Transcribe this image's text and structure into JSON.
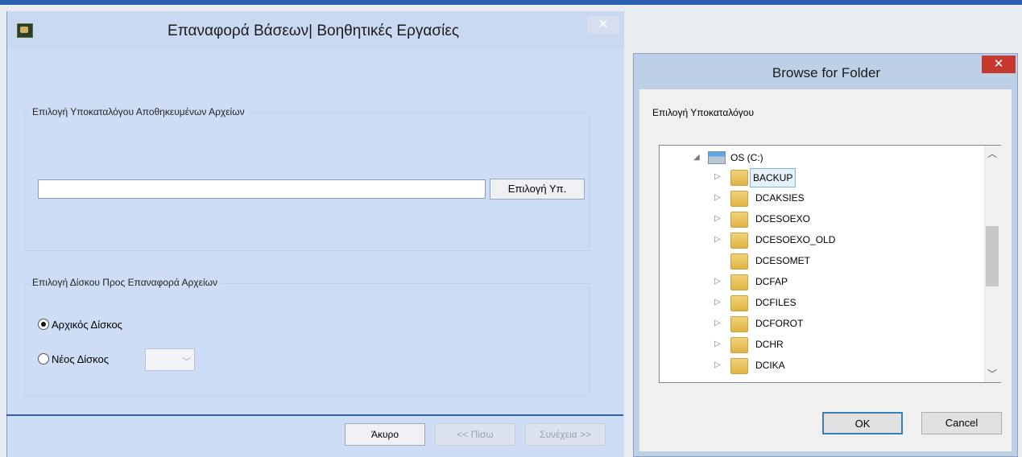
{
  "wizard": {
    "title": "Επαναφορά Βάσεων| Βοηθητικές Εργασίες",
    "close_label": "✕",
    "group1": {
      "legend": "Επιλογή Υποκαταλόγου Αποθηκευμένων Αρχείων",
      "path_value": "",
      "browse_label": "Επιλογή Υπ."
    },
    "group2": {
      "legend": "Επιλογή Δίσκου Προς Επαναφορά Αρχείων",
      "radio_original_label": "Αρχικός Δίσκος",
      "radio_original_selected": true,
      "radio_new_label": "Νέος Δίσκος",
      "new_disk_value": ""
    },
    "buttons": {
      "cancel": "Άκυρο",
      "back": "<< Πίσω",
      "next": "Συνέχεια >>"
    }
  },
  "dialog": {
    "title": "Browse for Folder",
    "close_label": "✕",
    "description": "Επιλογή Υποκαταλόγου",
    "drive": "OS (C:)",
    "folders": [
      {
        "name": "BACKUP",
        "expandable": true,
        "selected": true
      },
      {
        "name": "DCAKSIES",
        "expandable": true,
        "selected": false
      },
      {
        "name": "DCESOEXO",
        "expandable": true,
        "selected": false
      },
      {
        "name": "DCESOEXO_OLD",
        "expandable": true,
        "selected": false
      },
      {
        "name": "DCESOMET",
        "expandable": false,
        "selected": false
      },
      {
        "name": "DCFAP",
        "expandable": true,
        "selected": false
      },
      {
        "name": "DCFILES",
        "expandable": true,
        "selected": false
      },
      {
        "name": "DCFOROT",
        "expandable": true,
        "selected": false
      },
      {
        "name": "DCHR",
        "expandable": true,
        "selected": false
      },
      {
        "name": "DCIKA",
        "expandable": true,
        "selected": false
      }
    ],
    "ok_label": "OK",
    "cancel_label": "Cancel"
  }
}
